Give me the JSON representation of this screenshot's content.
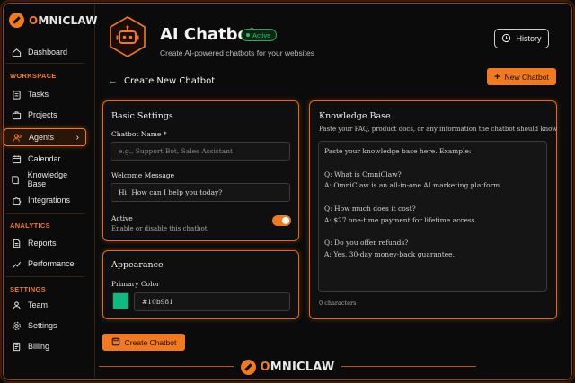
{
  "brand": {
    "name_prefix": "O",
    "name_rest": "MNICLAW"
  },
  "sidebar": {
    "items_top": [
      {
        "label": "Dashboard",
        "icon": "home-icon"
      }
    ],
    "workspace_label": "WORKSPACE",
    "workspace": [
      {
        "label": "Tasks",
        "icon": "clipboard-icon"
      },
      {
        "label": "Projects",
        "icon": "briefcase-icon"
      },
      {
        "label": "Agents",
        "icon": "users-icon",
        "active": true
      },
      {
        "label": "Calendar",
        "icon": "calendar-icon"
      },
      {
        "label": "Knowledge Base",
        "icon": "book-icon"
      },
      {
        "label": "Integrations",
        "icon": "puzzle-icon"
      }
    ],
    "analytics_label": "ANALYTICS",
    "analytics": [
      {
        "label": "Reports",
        "icon": "file-icon"
      },
      {
        "label": "Performance",
        "icon": "trend-icon"
      }
    ],
    "settings_label": "SETTINGS",
    "settings": [
      {
        "label": "Team",
        "icon": "team-icon"
      },
      {
        "label": "Settings",
        "icon": "gear-icon"
      },
      {
        "label": "Billing",
        "icon": "billing-icon"
      }
    ]
  },
  "header": {
    "title": "AI Chatbot",
    "badge": "Active",
    "subtitle": "Create AI-powered chatbots for your websites",
    "history_label": "History",
    "new_label": "New Chatbot"
  },
  "page": {
    "heading": "Create New Chatbot"
  },
  "basic": {
    "title": "Basic Settings",
    "name_label": "Chatbot Name *",
    "name_placeholder": "e.g., Support Bot, Sales Assistant",
    "welcome_label": "Welcome Message",
    "welcome_value": "Hi! How can I help you today?",
    "active_label": "Active",
    "active_hint": "Enable or disable this chatbot",
    "active_on": true
  },
  "appearance": {
    "title": "Appearance",
    "color_label": "Primary Color",
    "color_value": "#10b981"
  },
  "knowledge": {
    "title": "Knowledge Base",
    "description": "Paste your FAQ, product docs, or any information the chatbot should know",
    "lines": [
      "Paste your knowledge base here. Example:",
      "",
      "Q: What is OmniClaw?",
      "A: OmniClaw is an all-in-one AI marketing platform.",
      "",
      "Q: How much does it cost?",
      "A: $27 one-time payment for lifetime access.",
      "",
      "Q: Do you offer refunds?",
      "A: Yes, 30-day money-back guarantee."
    ],
    "char_count": "0 characters"
  },
  "create_label": "Create Chatbot",
  "colors": {
    "accent": "#f07a1d",
    "active_green": "#22c55e",
    "bg": "#0b0b0c"
  }
}
